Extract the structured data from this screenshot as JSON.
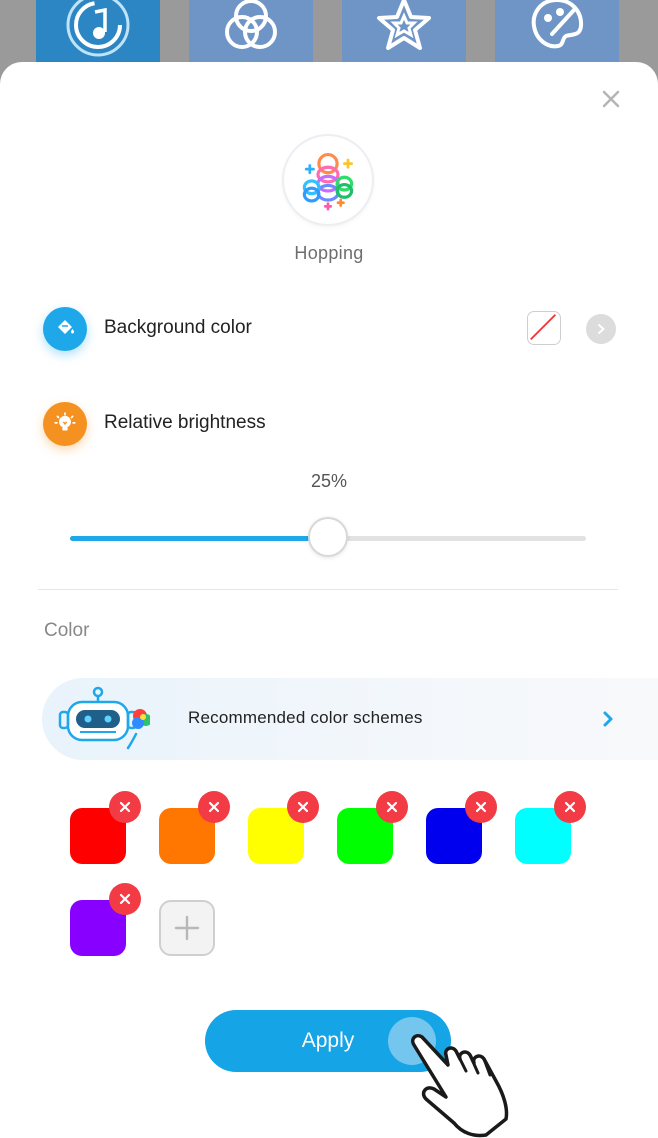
{
  "background_modes": [
    {
      "name": "music-mode",
      "icon": "music-note-icon",
      "active": true
    },
    {
      "name": "color-mix-mode",
      "icon": "venn-circles-icon",
      "active": false
    },
    {
      "name": "star-mode",
      "icon": "star-icon",
      "active": false
    },
    {
      "name": "palette-mode",
      "icon": "palette-icon",
      "active": false
    }
  ],
  "sheet": {
    "close_icon": "close-icon",
    "mode_name": "Hopping",
    "background_color": {
      "label": "Background color",
      "icon": "paint-bucket-icon",
      "value": "none"
    },
    "brightness": {
      "label": "Relative brightness",
      "icon": "lightbulb-icon",
      "value_text": "25%",
      "slider_fraction": 0.5
    },
    "color_section_label": "Color",
    "recommended": {
      "label": "Recommended color schemes",
      "icon": "robot-icon"
    },
    "colors": [
      "#ff0000",
      "#ff7700",
      "#ffff00",
      "#00ff00",
      "#0000ee",
      "#00ffff",
      "#8800ff"
    ],
    "apply_label": "Apply"
  },
  "accent_color": "#15a4e6"
}
